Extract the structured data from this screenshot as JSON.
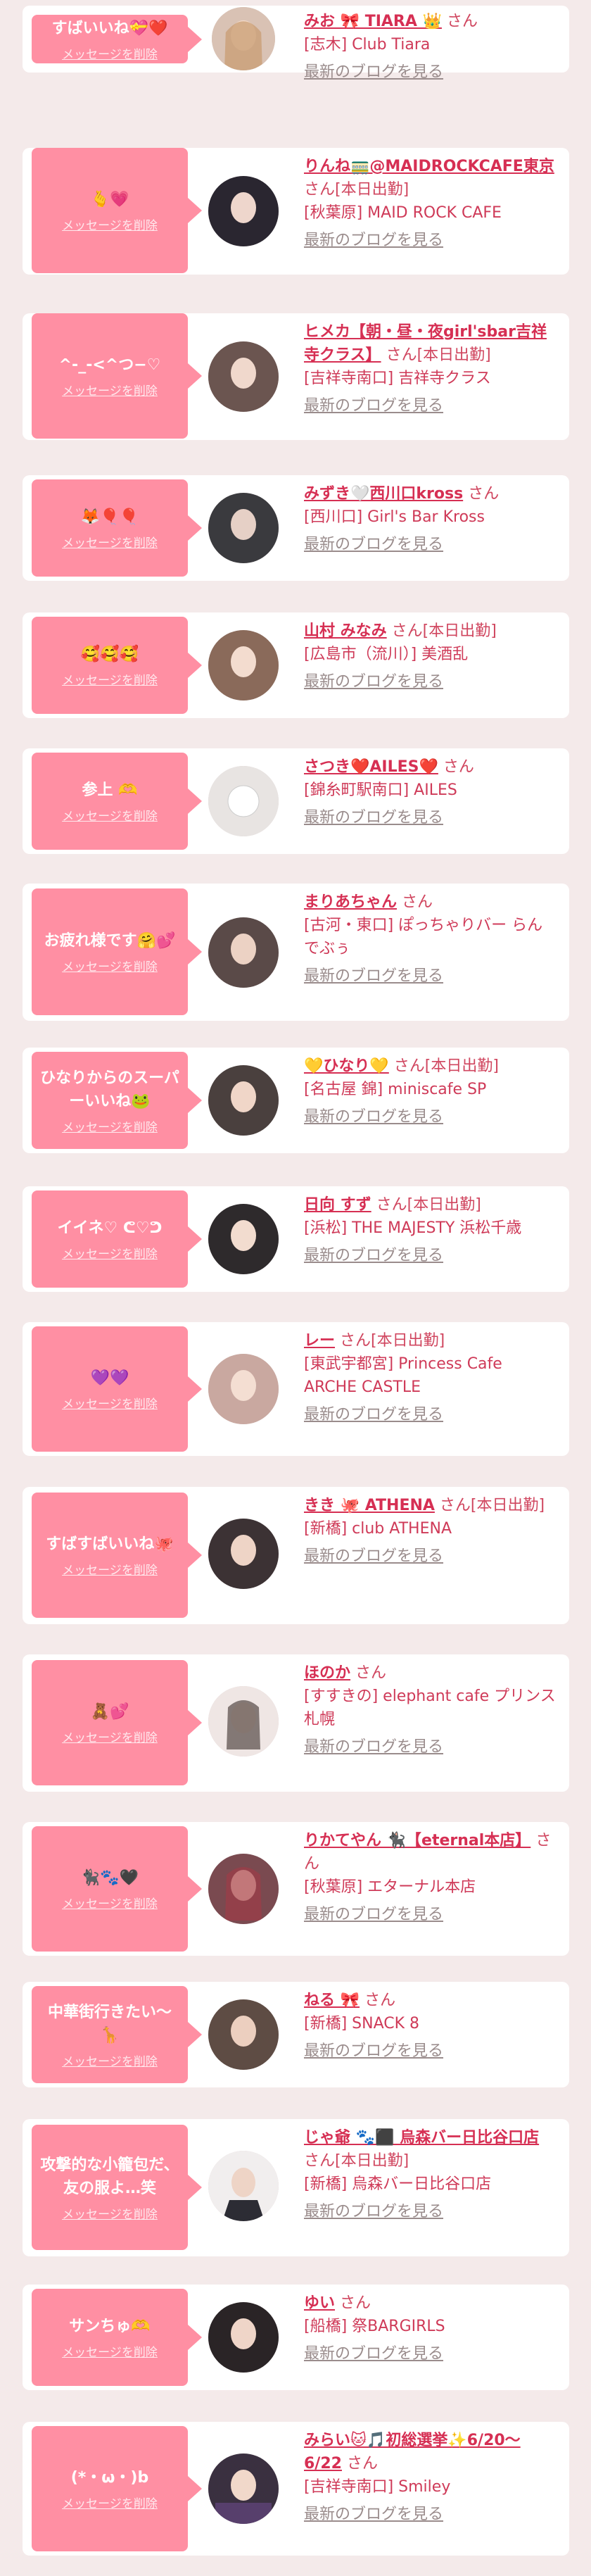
{
  "common": {
    "delete_label": "メッセージを削除",
    "blog_label": "最新のブログを見る"
  },
  "items": [
    {
      "message": "すばいいね💝❤️",
      "name": "みお 🎀 TIARA 👑",
      "suffix": "さん",
      "shop": "[志木] Club Tiara"
    },
    {
      "message": "🫰💗",
      "name": "りんね🚃@MAIDROCKCAFE東京",
      "suffix": "さん[本日出勤]",
      "shop": "[秋葉原] MAID ROCK CAFE"
    },
    {
      "message": "^-_-<^つ−♡",
      "name": "ヒメカ【朝・昼・夜girl'sbar吉祥寺クラス】",
      "suffix": "さん[本日出勤]",
      "shop": "[吉祥寺南口] 吉祥寺クラス"
    },
    {
      "message": "🦊🎈🎈",
      "name": "みずき🤍西川口kross",
      "suffix": "さん",
      "shop": "[西川口] Girl's Bar Kross"
    },
    {
      "message": "🥰🥰🥰",
      "name": "山村 みなみ",
      "suffix": "さん[本日出勤]",
      "shop": "[広島市（流川）] 美酒乱"
    },
    {
      "message": "参上 🫶",
      "name": "さつき❤️AILES❤️",
      "suffix": "さん",
      "shop": "[錦糸町駅南口] AILES"
    },
    {
      "message": "お疲れ様です🤗💕",
      "name": "まりあちゃん",
      "suffix": "さん",
      "shop": "[古河・東口] ぽっちゃりバー らんでぶぅ"
    },
    {
      "message": "ひなりからのスーパーいいね🐸",
      "name": "💛ひなり💛",
      "suffix": "さん[本日出勤]",
      "shop": "[名古屋 錦] miniscafe SP"
    },
    {
      "message": "イイネ♡ ᕦ♡ᕤ",
      "name": "日向 すず",
      "suffix": "さん[本日出勤]",
      "shop": "[浜松] THE MAJESTY 浜松千歳"
    },
    {
      "message": "💜💜",
      "name": "レー",
      "suffix": "さん[本日出勤]",
      "shop": "[東武宇都宮] Princess Cafe ARCHE CASTLE"
    },
    {
      "message": "すばすばいいね🐙",
      "name": "きき 🐙 ATHENA",
      "suffix": "さん[本日出勤]",
      "shop": "[新橋] club ATHENA"
    },
    {
      "message": "🧸💕",
      "name": "ほのか",
      "suffix": "さん",
      "shop": "[すすきの] elephant cafe プリンス 札幌"
    },
    {
      "message": "🐈‍⬛🐾🖤",
      "name": "りかてやん 🐈‍⬛【eternal本店】",
      "suffix": "さん",
      "shop": "[秋葉原] エターナル本店"
    },
    {
      "message": "中華街行きたい〜🦒",
      "name": "ねる 🎀",
      "suffix": "さん",
      "shop": "[新橋] SNACK 8"
    },
    {
      "message": "攻撃的な小籠包だ、友の服よ…笑",
      "name": "じゃ爺 🐾⬛ 烏森バー日比谷口店",
      "suffix": "さん[本日出勤]",
      "shop": "[新橋] 烏森バー日比谷口店"
    },
    {
      "message": "サンちゅ🫶",
      "name": "ゆい",
      "suffix": "さん",
      "shop": "[船橋] 祭BARGIRLS"
    },
    {
      "message": "(*・ω・)b",
      "name": "みらい🐱🎵初総選挙✨6/20〜6/22",
      "suffix": "さん",
      "shop": "[吉祥寺南口] Smiley"
    }
  ]
}
